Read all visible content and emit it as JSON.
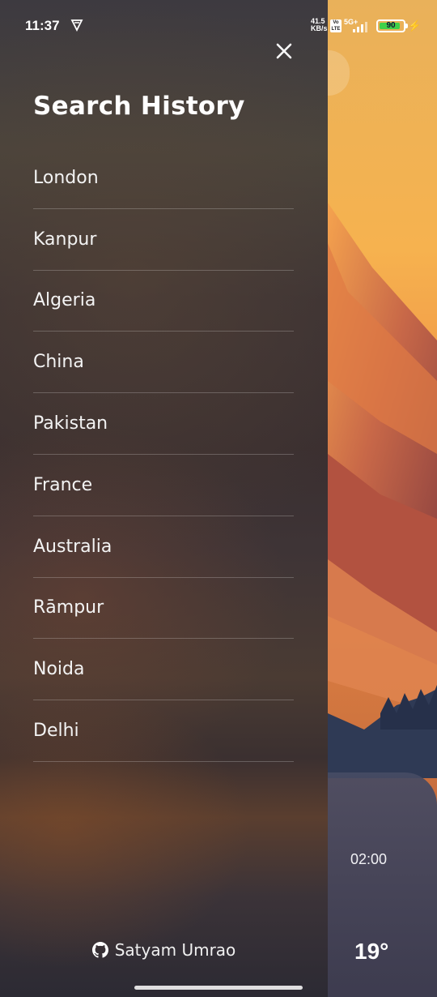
{
  "status_bar": {
    "time": "11:37",
    "net_speed_value": "41.5",
    "net_speed_unit": "KB/s",
    "volte_label": "Vo LTE",
    "network_type": "5G+",
    "battery_percent": "90",
    "battery_level": 0.9
  },
  "weather_background": {
    "hourly_time": "02:00",
    "hourly_temp": "19°",
    "hourly_icon": "cloud-icon"
  },
  "drawer": {
    "title": "Search History",
    "history": [
      {
        "label": "London"
      },
      {
        "label": "Kanpur"
      },
      {
        "label": "Algeria"
      },
      {
        "label": "China"
      },
      {
        "label": "Pakistan"
      },
      {
        "label": "France"
      },
      {
        "label": "Australia"
      },
      {
        "label": "Rāmpur"
      },
      {
        "label": "Noida"
      },
      {
        "label": "Delhi"
      }
    ],
    "footer_credit": "Satyam Umrao",
    "footer_icon": "github-icon"
  },
  "colors": {
    "battery_green": "#3fd14a",
    "divider": "rgba(255,255,255,0.22)"
  }
}
